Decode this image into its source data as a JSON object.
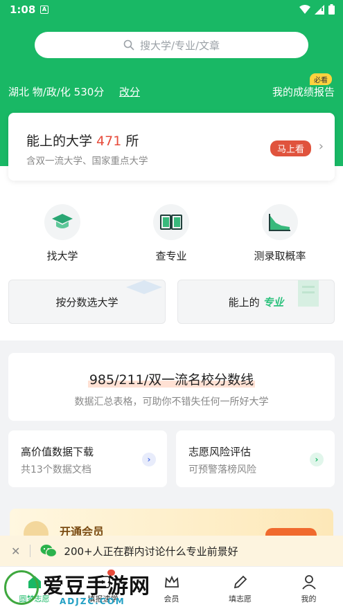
{
  "status": {
    "time": "1:08",
    "badge_letter": "A"
  },
  "search": {
    "placeholder": "搜大学/专业/文章"
  },
  "score": {
    "info": "湖北 物/政/化 530分",
    "change_label": "改分",
    "report_label": "我的成绩报告",
    "report_badge": "必看"
  },
  "main_card": {
    "title_prefix": "能上的大学 ",
    "count": "471",
    "title_suffix": " 所",
    "subtitle": "含双一流大学、国家重点大学",
    "action": "马上看"
  },
  "features": [
    {
      "label": "找大学",
      "icon": "graduation-cap-icon"
    },
    {
      "label": "查专业",
      "icon": "book-icon"
    },
    {
      "label": "测录取概率",
      "icon": "area-chart-icon"
    }
  ],
  "options": {
    "by_score": "按分数选大学",
    "possible_prefix": "能上的 ",
    "possible_em": "专业"
  },
  "banner": {
    "title": "985/211/双一流名校分数线",
    "subtitle": "数据汇总表格，可助你不错失任何一所好大学"
  },
  "mini_cards": [
    {
      "title": "高价值数据下载",
      "subtitle": "共13个数据文档",
      "arrow_color": "#e8ecfb",
      "arrow_fg": "#4a6de5"
    },
    {
      "title": "志愿风险评估",
      "subtitle": "可预警落榜风险",
      "arrow_color": "#e1f6eb",
      "arrow_fg": "#19b865"
    }
  ],
  "member": {
    "title": "开通会员"
  },
  "notice": {
    "text": "200+人正在群内讨论什么专业前景好"
  },
  "tabs": [
    {
      "label": "圆梦志愿",
      "active": true
    },
    {
      "label": "填报速学",
      "active": false
    },
    {
      "label": "会员",
      "active": false
    },
    {
      "label": "填志愿",
      "active": false
    },
    {
      "label": "我的",
      "active": false
    }
  ],
  "watermark": {
    "main": "爱豆手游网",
    "domain": "ADJZC.COM"
  },
  "colors": {
    "brand": "#19b865",
    "accent": "#e0533d"
  }
}
